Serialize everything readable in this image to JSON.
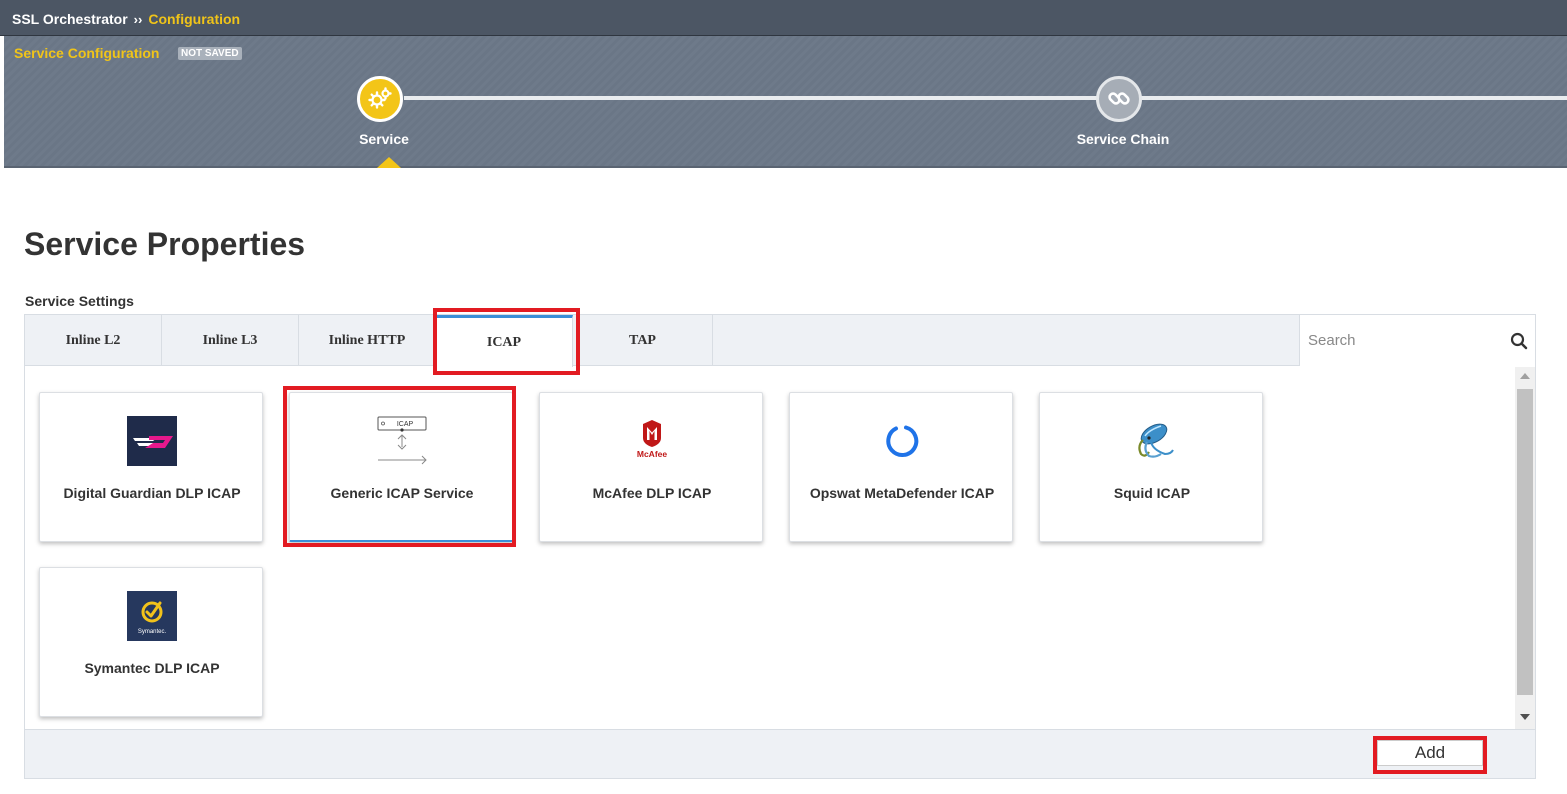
{
  "breadcrumb": {
    "root": "SSL Orchestrator",
    "separator": "››",
    "current": "Configuration"
  },
  "wizard": {
    "title": "Service Configuration",
    "status_badge": "NOT SAVED",
    "steps": [
      {
        "label": "Service",
        "icon": "gears-icon",
        "state": "active"
      },
      {
        "label": "Service Chain",
        "icon": "chain-link-icon",
        "state": "inactive"
      }
    ]
  },
  "page": {
    "title": "Service Properties",
    "settings_label": "Service Settings"
  },
  "tabs": [
    {
      "label": "Inline L2",
      "active": false
    },
    {
      "label": "Inline L3",
      "active": false
    },
    {
      "label": "Inline HTTP",
      "active": false
    },
    {
      "label": "ICAP",
      "active": true
    },
    {
      "label": "TAP",
      "active": false
    }
  ],
  "search": {
    "placeholder": "Search",
    "value": ""
  },
  "services": [
    {
      "name": "Digital Guardian DLP ICAP",
      "logo": "digital-guardian-logo",
      "selected": false
    },
    {
      "name": "Generic ICAP Service",
      "logo": "generic-icap-diagram-icon",
      "logo_text": "ICAP",
      "selected": true
    },
    {
      "name": "McAfee DLP ICAP",
      "logo": "mcafee-logo",
      "logo_text": "McAfee",
      "selected": false
    },
    {
      "name": "Opswat MetaDefender ICAP",
      "logo": "opswat-ring-logo",
      "selected": false
    },
    {
      "name": "Squid ICAP",
      "logo": "squid-logo",
      "selected": false
    },
    {
      "name": "Symantec DLP ICAP",
      "logo": "symantec-logo",
      "logo_text": "Symantec.",
      "selected": false
    }
  ],
  "footer": {
    "add_label": "Add"
  },
  "colors": {
    "accent_yellow": "#f3c518",
    "highlight_red": "#e21b22",
    "active_tab_blue": "#3a8fd8",
    "header_gray": "#6e7a8a"
  }
}
